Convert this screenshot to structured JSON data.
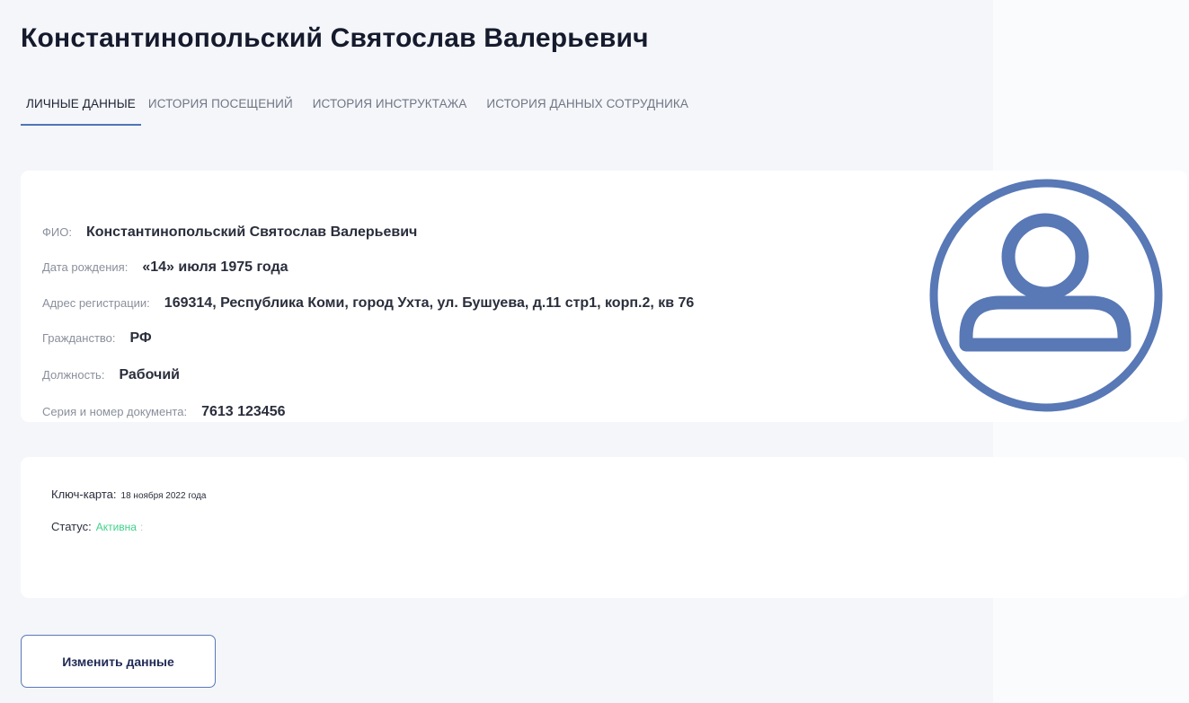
{
  "page": {
    "title": "Константинопольский Святослав Валерьевич"
  },
  "tabs": [
    {
      "label": "Личные данные",
      "active": true
    },
    {
      "label": "История посещений",
      "active": false
    },
    {
      "label": "История инструктажа",
      "active": false
    },
    {
      "label": "История данных сотрудника",
      "active": false
    }
  ],
  "personal": {
    "fio_label": "ФИО:",
    "fio_value": "Константинопольский Святослав Валерьевич",
    "birth_label": "Дата рождения:",
    "birth_value": "«14» июля 1975 года",
    "address_label": "Адрес регистрации:",
    "address_value": "169314, Республика Коми, город Ухта, ул. Бушуева, д.11 стр1, корп.2, кв 76",
    "citizenship_label": "Гражданство:",
    "citizenship_value": "РФ",
    "position_label": "Должность:",
    "position_value": "Рабочий",
    "document_label": "Серия и номер документа:",
    "document_value": "7613 123456",
    "avatar_icon": "user-avatar-icon"
  },
  "key_card": {
    "label": "Ключ-карта:",
    "date": "18 ноября 2022 года",
    "status_label": "Статус:",
    "status_value": "Активна",
    "status_separator": ":"
  },
  "actions": {
    "edit_label": "Изменить данные"
  },
  "colors": {
    "accent": "#4f74b5",
    "status_active": "#3fd08a",
    "background": "#f4f6f9",
    "avatar": "#5878b6"
  }
}
